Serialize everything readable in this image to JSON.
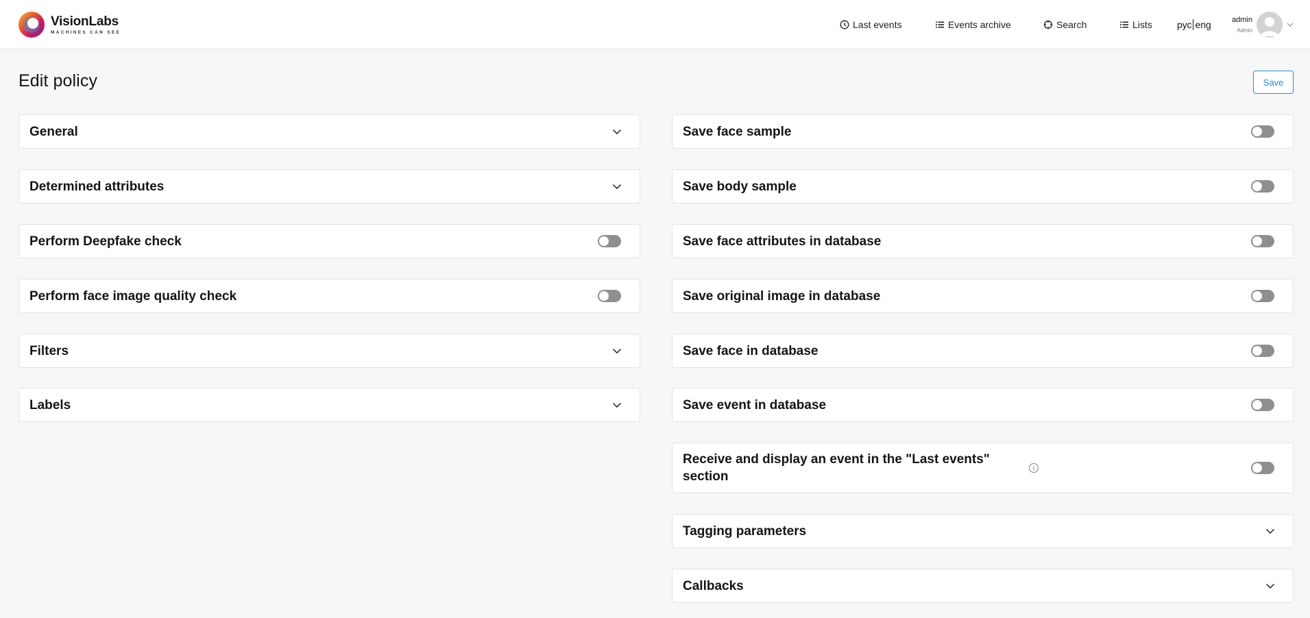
{
  "brand": {
    "name": "VisionLabs",
    "tagline": "MACHINES CAN SEE"
  },
  "nav": [
    {
      "label": "Last events",
      "icon": "clock-icon"
    },
    {
      "label": "Events archive",
      "icon": "list-icon"
    },
    {
      "label": "Search",
      "icon": "target-icon"
    },
    {
      "label": "Lists",
      "icon": "list-icon"
    }
  ],
  "lang": {
    "ru": "рус",
    "en": "eng"
  },
  "user": {
    "name": "admin",
    "role": "Admin"
  },
  "page": {
    "title": "Edit policy",
    "save_label": "Save"
  },
  "left_cards": [
    {
      "label": "General",
      "control": "chevron"
    },
    {
      "label": "Determined attributes",
      "control": "chevron"
    },
    {
      "label": "Perform Deepfake check",
      "control": "toggle",
      "on": false
    },
    {
      "label": "Perform face image quality check",
      "control": "toggle",
      "on": false
    },
    {
      "label": "Filters",
      "control": "chevron"
    },
    {
      "label": "Labels",
      "control": "chevron"
    }
  ],
  "right_cards": [
    {
      "label": "Save face sample",
      "control": "toggle",
      "on": false
    },
    {
      "label": "Save body sample",
      "control": "toggle",
      "on": false
    },
    {
      "label": "Save face attributes in database",
      "control": "toggle",
      "on": false
    },
    {
      "label": "Save original image in database",
      "control": "toggle",
      "on": false
    },
    {
      "label": "Save face in database",
      "control": "toggle",
      "on": false
    },
    {
      "label": "Save event in database",
      "control": "toggle",
      "on": false
    },
    {
      "label": "Receive and display an event in the \"Last events\" section",
      "control": "toggle",
      "on": false,
      "info_icon": true
    },
    {
      "label": "Tagging parameters",
      "control": "chevron"
    },
    {
      "label": "Callbacks",
      "control": "chevron"
    }
  ]
}
